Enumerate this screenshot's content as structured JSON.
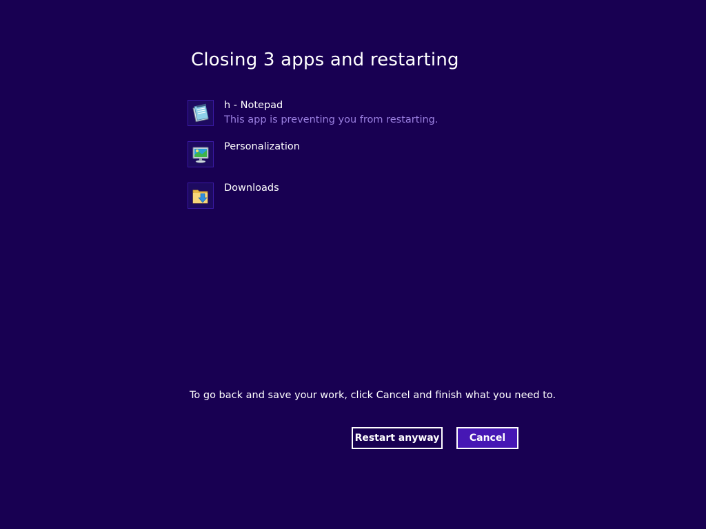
{
  "title": "Closing 3 apps and restarting",
  "apps": [
    {
      "name": "h - Notepad",
      "status": "This app is preventing you from restarting.",
      "icon": "notepad-icon"
    },
    {
      "name": "Personalization",
      "status": "",
      "icon": "personalization-icon"
    },
    {
      "name": "Downloads",
      "status": "",
      "icon": "downloads-folder-icon"
    }
  ],
  "hint": "To go back and save your work, click Cancel and finish what you need to.",
  "buttons": {
    "restart_label": "Restart anyway",
    "cancel_label": "Cancel"
  },
  "colors": {
    "background": "#180052",
    "status_text": "#9a7fe0",
    "cancel_button": "#4617b4"
  }
}
